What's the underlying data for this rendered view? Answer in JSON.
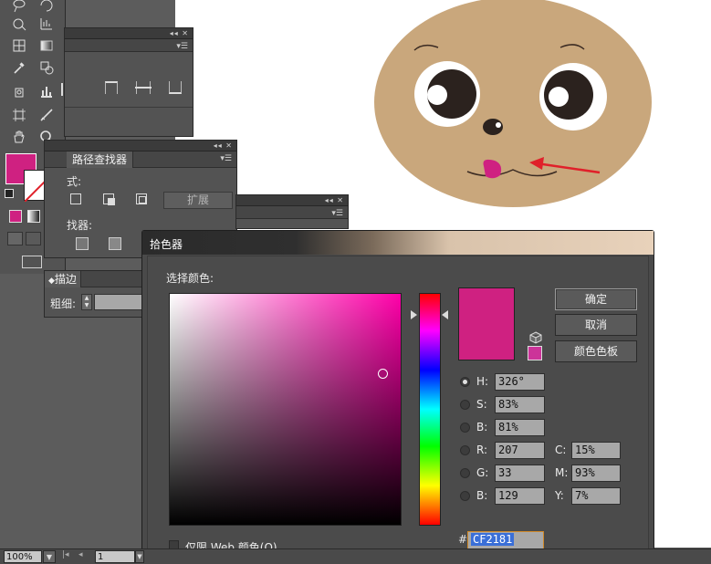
{
  "colors": {
    "panel": "#535353",
    "accent": "#cf2181",
    "face": "#c9a77c",
    "arrow": "#e0202a",
    "hex_highlight": "#3a6fd8"
  },
  "pathfinder": {
    "tab_label": "路径查找器",
    "shape_mode_label": "式:",
    "finder_label": "找器:",
    "expand_button": "扩展"
  },
  "stroke": {
    "tab_label": "描边",
    "weight_label": "粗细:"
  },
  "color_picker": {
    "title": "拾色器",
    "select_label": "选择颜色:",
    "buttons": {
      "ok": "确定",
      "cancel": "取消",
      "swatches": "颜色色板"
    },
    "hsb": [
      {
        "label": "H:",
        "value": "326°",
        "selected": true
      },
      {
        "label": "S:",
        "value": "83%",
        "selected": false
      },
      {
        "label": "B:",
        "value": "81%",
        "selected": false
      }
    ],
    "rgb": [
      {
        "label": "R:",
        "value": "207"
      },
      {
        "label": "G:",
        "value": "33"
      },
      {
        "label": "B:",
        "value": "129"
      }
    ],
    "cmyk": [
      {
        "label": "C:",
        "value": "15%"
      },
      {
        "label": "M:",
        "value": "93%"
      },
      {
        "label": "Y:",
        "value": "7%"
      }
    ],
    "hex_prefix": "#",
    "hex": "CF2181",
    "web_only_label": "仅限 Web 颜色(O)"
  },
  "statusbar": {
    "zoom": "100%",
    "page": "1"
  },
  "icons": {
    "tools": [
      "lasso-icon",
      "rotate-icon",
      "graph-icon",
      "mesh-icon",
      "gradient-icon",
      "eyedropper-icon",
      "blend-icon",
      "symbol-sprayer-icon",
      "column-graph-icon",
      "artboard-icon",
      "slice-icon",
      "hand-icon",
      "zoom-icon"
    ]
  }
}
